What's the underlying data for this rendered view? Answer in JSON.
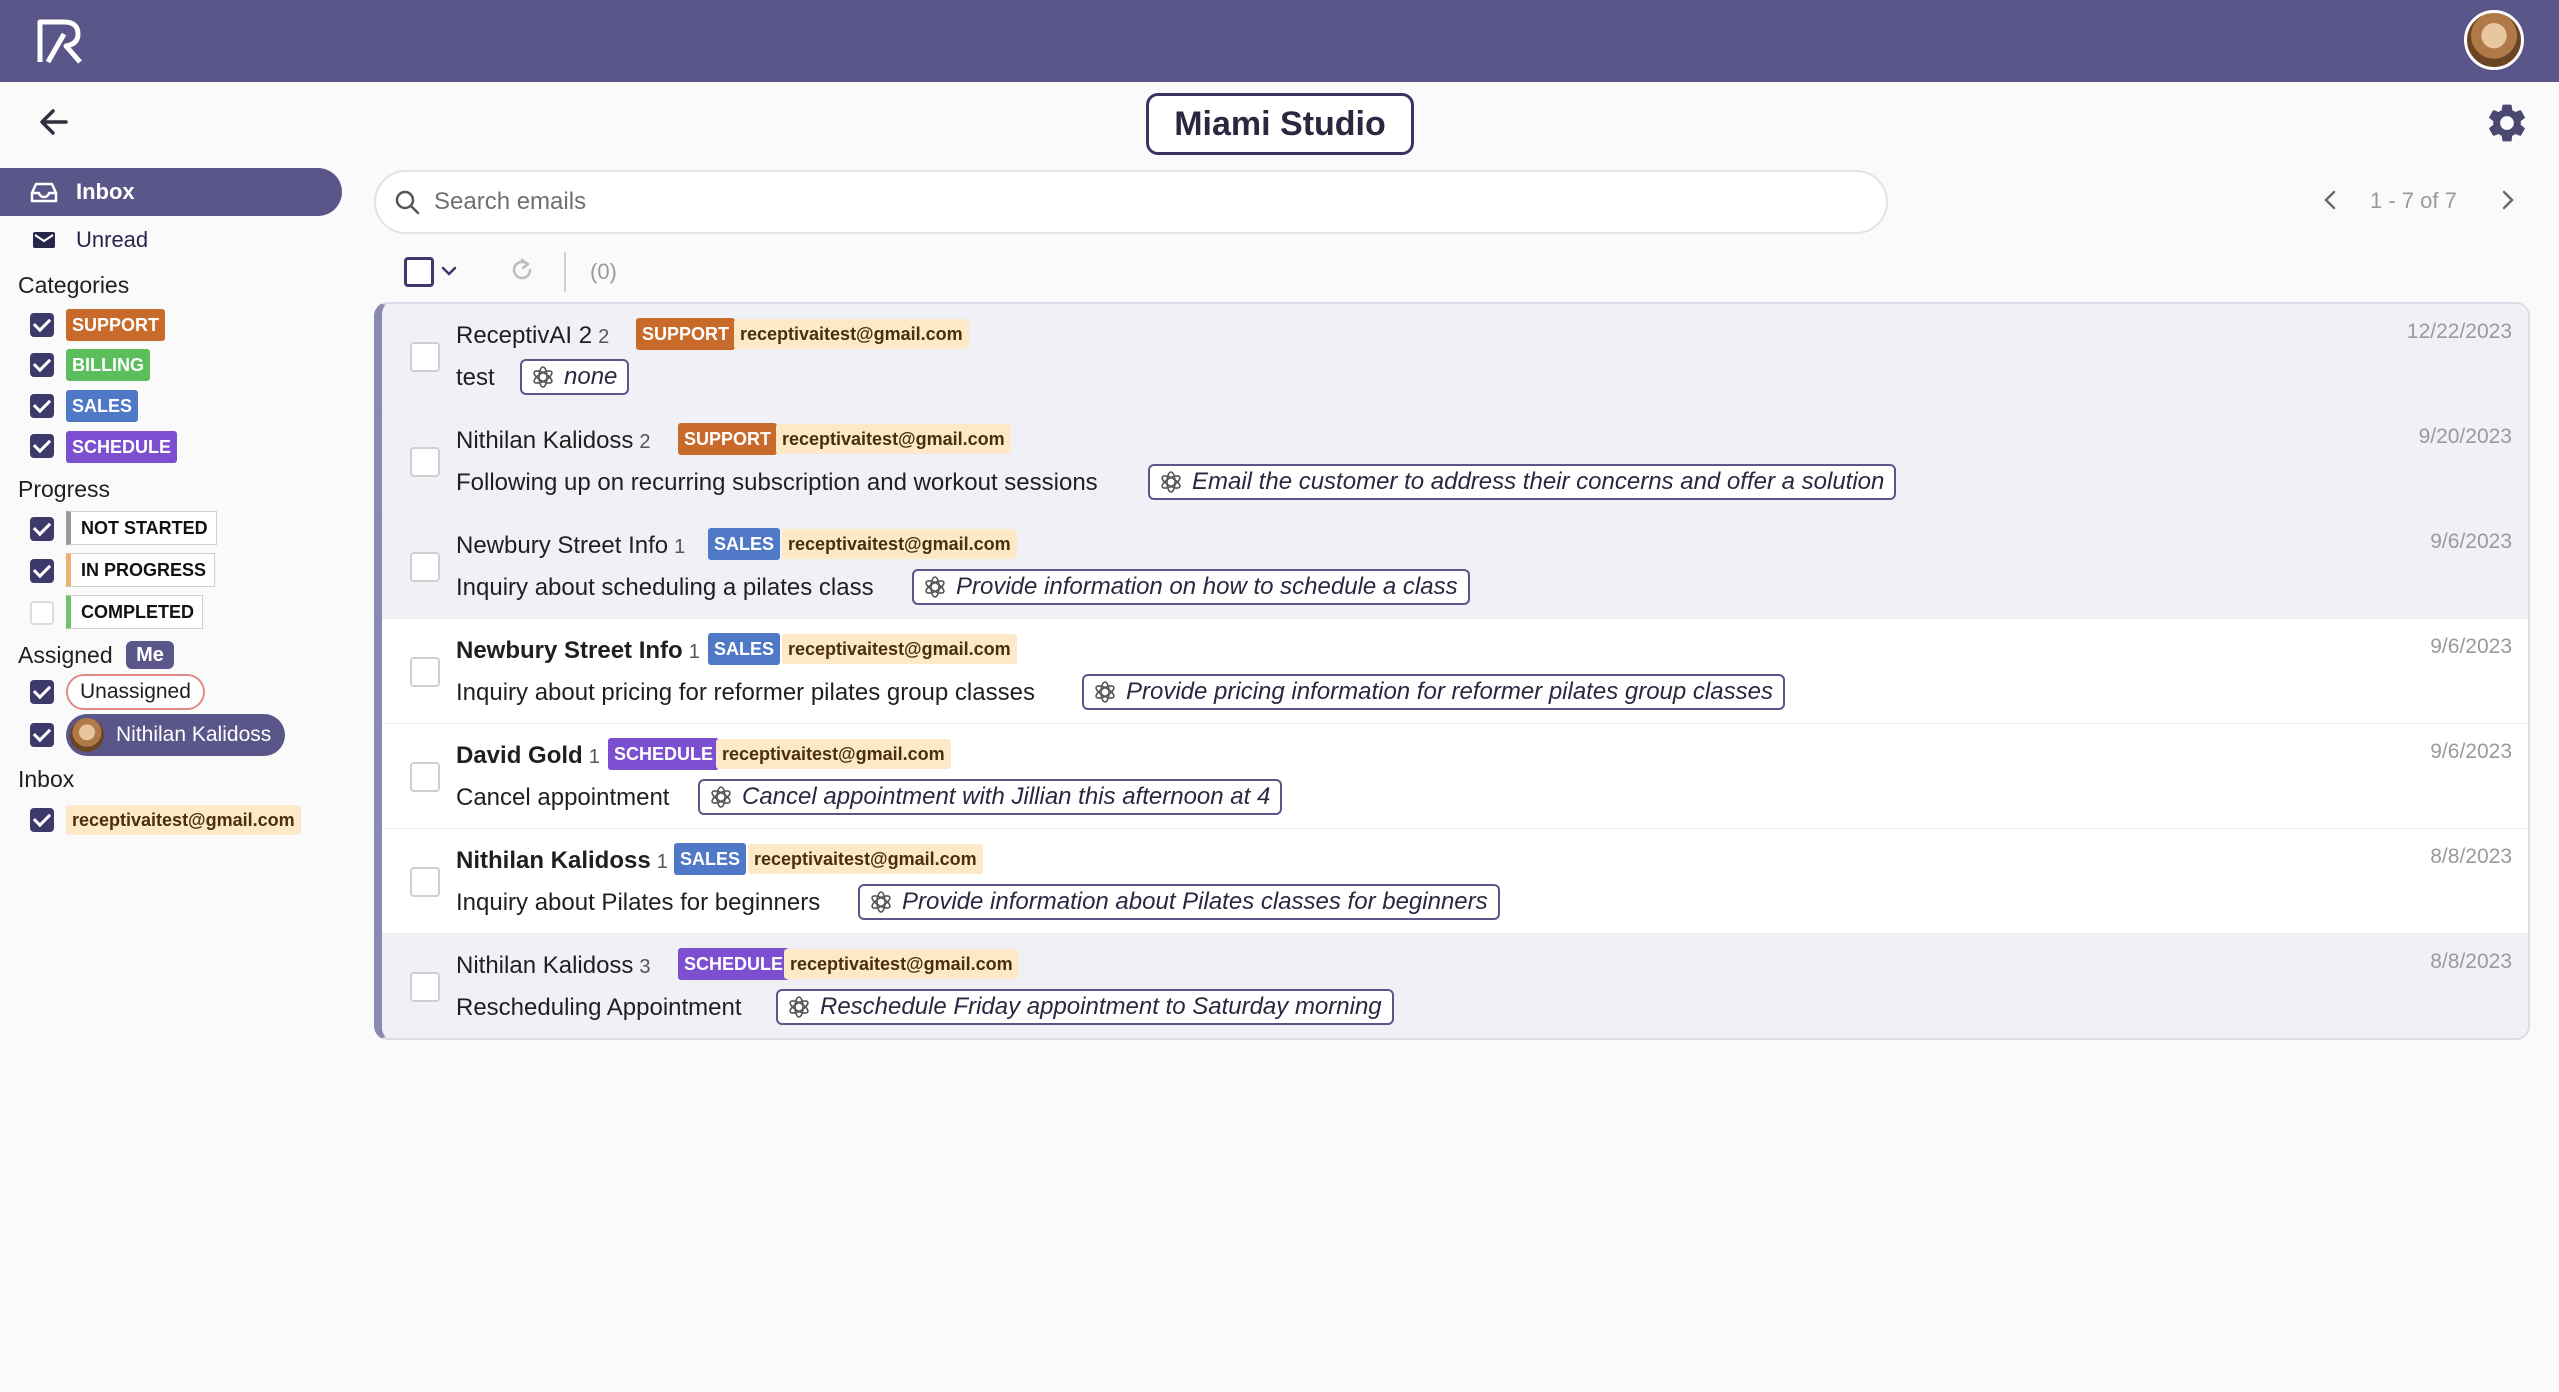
{
  "header": {
    "studio_name": "Miami Studio",
    "colors": {
      "topbar": "#5b5689",
      "accent": "#3d3a6b"
    }
  },
  "sidebar": {
    "inbox_label": "Inbox",
    "unread_label": "Unread",
    "categories_heading": "Categories",
    "categories": [
      "SUPPORT",
      "BILLING",
      "SALES",
      "SCHEDULE"
    ],
    "progress_heading": "Progress",
    "progress": [
      {
        "label": "NOT STARTED",
        "checked": true
      },
      {
        "label": "IN PROGRESS",
        "checked": true
      },
      {
        "label": "COMPLETED",
        "checked": false
      }
    ],
    "assigned_heading": "Assigned",
    "me_badge": "Me",
    "unassigned_label": "Unassigned",
    "assignee_name": "Nithilan Kalidoss",
    "inbox_heading": "Inbox",
    "inbox_account": "receptivaitest@gmail.com"
  },
  "search": {
    "placeholder": "Search emails"
  },
  "pager": {
    "range": "1 - 7 of 7"
  },
  "toolbar": {
    "selected_count": "(0)"
  },
  "emails": [
    {
      "sender": "ReceptivAI 2",
      "count": "2",
      "category": "SUPPORT",
      "account": "receptivaitest@gmail.com",
      "subject": "test",
      "ai_action": "none",
      "date": "12/22/2023",
      "read": true
    },
    {
      "sender": "Nithilan Kalidoss",
      "count": "2",
      "category": "SUPPORT",
      "account": "receptivaitest@gmail.com",
      "subject": "Following up on recurring subscription and workout sessions",
      "ai_action": "Email the customer to address their concerns and offer a solution",
      "date": "9/20/2023",
      "read": true
    },
    {
      "sender": "Newbury Street Info",
      "count": "1",
      "category": "SALES",
      "account": "receptivaitest@gmail.com",
      "subject": "Inquiry about scheduling a pilates class",
      "ai_action": "Provide information on how to schedule a class",
      "date": "9/6/2023",
      "read": true
    },
    {
      "sender": "Newbury Street Info",
      "count": "1",
      "category": "SALES",
      "account": "receptivaitest@gmail.com",
      "subject": "Inquiry about pricing for reformer pilates group classes",
      "ai_action": "Provide pricing information for reformer pilates group classes",
      "date": "9/6/2023",
      "read": false
    },
    {
      "sender": "David Gold",
      "count": "1",
      "category": "SCHEDULE",
      "account": "receptivaitest@gmail.com",
      "subject": "Cancel appointment",
      "ai_action": "Cancel appointment with Jillian this afternoon at 4",
      "date": "9/6/2023",
      "read": false
    },
    {
      "sender": "Nithilan Kalidoss",
      "count": "1",
      "category": "SALES",
      "account": "receptivaitest@gmail.com",
      "subject": "Inquiry about Pilates for beginners",
      "ai_action": "Provide information about Pilates classes for beginners",
      "date": "8/8/2023",
      "read": false
    },
    {
      "sender": "Nithilan Kalidoss",
      "count": "3",
      "category": "SCHEDULE",
      "account": "receptivaitest@gmail.com",
      "subject": "Rescheduling Appointment",
      "ai_action": "Reschedule Friday appointment to Saturday morning",
      "date": "8/8/2023",
      "read": true
    }
  ]
}
